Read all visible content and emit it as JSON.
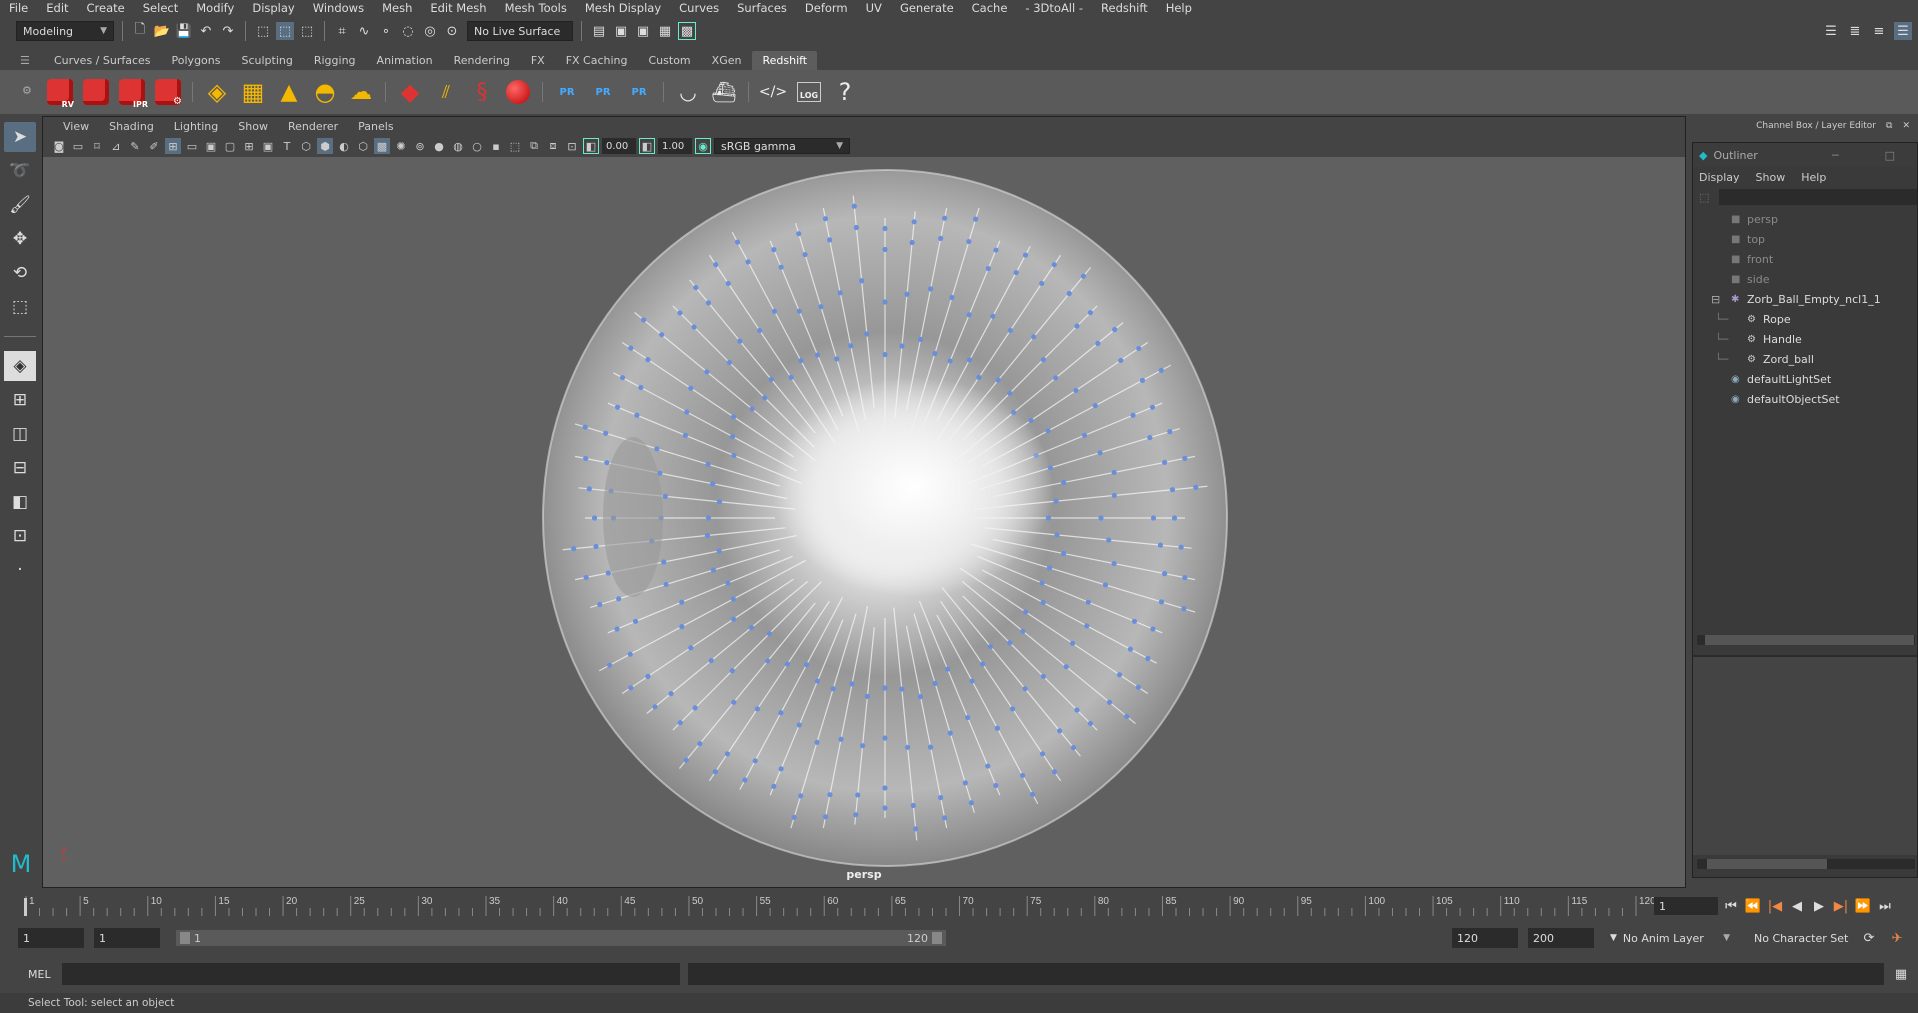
{
  "menu": [
    "File",
    "Edit",
    "Create",
    "Select",
    "Modify",
    "Display",
    "Windows",
    "Mesh",
    "Edit Mesh",
    "Mesh Tools",
    "Mesh Display",
    "Curves",
    "Surfaces",
    "Deform",
    "UV",
    "Generate",
    "Cache",
    "- 3DtoAll -",
    "Redshift",
    "Help"
  ],
  "status": {
    "mode": "Modeling",
    "live_surface": "No Live Surface"
  },
  "shelf_tabs": [
    {
      "label": "Curves / Surfaces",
      "active": false
    },
    {
      "label": "Polygons",
      "active": false
    },
    {
      "label": "Sculpting",
      "active": false
    },
    {
      "label": "Rigging",
      "active": false
    },
    {
      "label": "Animation",
      "active": false
    },
    {
      "label": "Rendering",
      "active": false
    },
    {
      "label": "FX",
      "active": false
    },
    {
      "label": "FX Caching",
      "active": false
    },
    {
      "label": "Custom",
      "active": false
    },
    {
      "label": "XGen",
      "active": false
    },
    {
      "label": "Redshift",
      "active": true
    }
  ],
  "shelf": {
    "rv": "RV",
    "ipr": "IPR",
    "pr": "PR",
    "log": "LOG",
    "help": "?"
  },
  "viewport": {
    "menu": [
      "View",
      "Shading",
      "Lighting",
      "Show",
      "Renderer",
      "Panels"
    ],
    "exposure": "0.00",
    "gamma": "1.00",
    "color_space": "sRGB gamma",
    "camera": "persp"
  },
  "right_panel": {
    "title": "Channel Box / Layer Editor",
    "outliner": {
      "title": "Outliner",
      "menu": [
        "Display",
        "Show",
        "Help"
      ],
      "items": [
        {
          "label": "persp",
          "icon": "camera-icon",
          "dim": true
        },
        {
          "label": "top",
          "icon": "camera-icon",
          "dim": true
        },
        {
          "label": "front",
          "icon": "camera-icon",
          "dim": true
        },
        {
          "label": "side",
          "icon": "camera-icon",
          "dim": true
        },
        {
          "label": "Zorb_Ball_Empty_ncl1_1",
          "icon": "ncloth-icon",
          "dim": false
        },
        {
          "label": "Rope",
          "icon": "mesh-icon",
          "dim": false
        },
        {
          "label": "Handle",
          "icon": "mesh-icon",
          "dim": false
        },
        {
          "label": "Zord_ball",
          "icon": "mesh-icon",
          "dim": false
        },
        {
          "label": "defaultLightSet",
          "icon": "set-icon",
          "dim": false
        },
        {
          "label": "defaultObjectSet",
          "icon": "set-icon",
          "dim": false
        }
      ]
    }
  },
  "timeline": {
    "ticks": [
      "1",
      "5",
      "10",
      "15",
      "20",
      "25",
      "30",
      "35",
      "40",
      "45",
      "50",
      "55",
      "60",
      "65",
      "70",
      "75",
      "80",
      "85",
      "90",
      "95",
      "100",
      "105",
      "110",
      "115",
      "120"
    ],
    "current_frame": "1"
  },
  "range": {
    "start": "1",
    "playback_start": "1",
    "slider_start": "1",
    "slider_end": "120",
    "playback_end": "120",
    "end": "200",
    "anim_layer": "No Anim Layer",
    "character_set": "No Character Set"
  },
  "command": {
    "lang": "MEL"
  },
  "help_line": "Select Tool: select an object"
}
